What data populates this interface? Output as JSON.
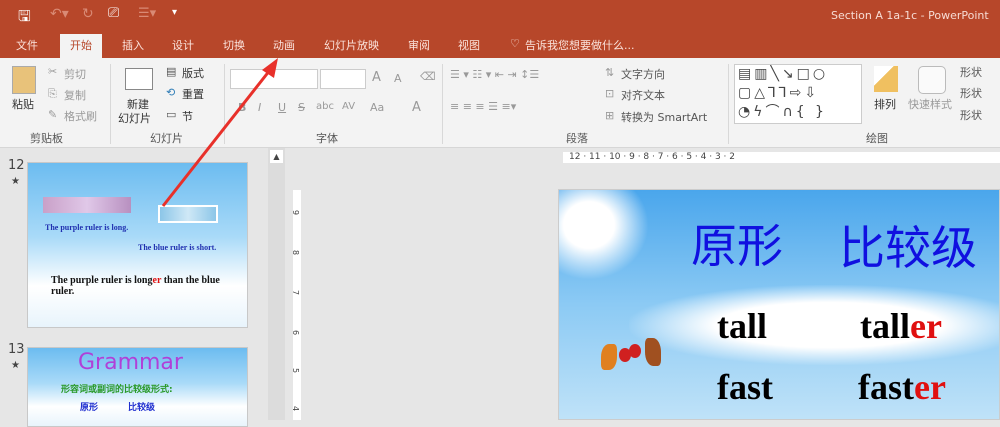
{
  "titlebar": {
    "title": "Section A 1a-1c - PowerPoint"
  },
  "tabs": [
    {
      "label": "文件"
    },
    {
      "label": "开始"
    },
    {
      "label": "插入"
    },
    {
      "label": "设计"
    },
    {
      "label": "切换"
    },
    {
      "label": "动画"
    },
    {
      "label": "幻灯片放映"
    },
    {
      "label": "审阅"
    },
    {
      "label": "视图"
    }
  ],
  "tell_me": "告诉我您想要做什么...",
  "ribbon": {
    "clipboard": {
      "paste": "粘贴",
      "cut": "剪切",
      "copy": "复制",
      "format_painter": "格式刷",
      "label": "剪贴板"
    },
    "slides": {
      "new_slide_1": "新建",
      "new_slide_2": "幻灯片",
      "layout": "版式",
      "reset": "重置",
      "section": "节",
      "label": "幻灯片"
    },
    "font": {
      "label": "字体",
      "grow": "A",
      "shrink": "A",
      "bold": "B",
      "italic": "I",
      "underline": "U",
      "strike": "S",
      "abc": "abc",
      "spacing": "AV",
      "case": "Aa",
      "color": "A"
    },
    "paragraph": {
      "text_direction": "文字方向",
      "align_text": "对齐文本",
      "smartart": "转换为 SmartArt",
      "label": "段落"
    },
    "drawing": {
      "arrange": "排列",
      "quick_styles": "快速样式",
      "shape_fill": "形状",
      "shape_outline": "形状",
      "shape_effects": "形状",
      "label": "绘图"
    }
  },
  "thumbnails": [
    {
      "number": "12",
      "star": "★",
      "text1": "The purple ruler is long.",
      "text2": "The blue ruler is short.",
      "text3a": "The purple ruler is long",
      "text3b": "er",
      "text3c": " than the blue ruler."
    },
    {
      "number": "13",
      "star": "★",
      "title": "Grammar",
      "subtitle": "形容词或副词的比较级形式:",
      "col1": "原形",
      "col2": "比较级"
    }
  ],
  "ruler": {
    "h": "12 · 11 · 10 · 9 · 8 · 7 · 6 · 5 · 4 · 3 · 2",
    "v": [
      "9",
      "8",
      "7",
      "6",
      "5",
      "4"
    ]
  },
  "slide": {
    "heading1": "原形",
    "heading2": "比较级",
    "rows": [
      {
        "base": "tall",
        "comp_stem": "tall",
        "comp_suffix": "er"
      },
      {
        "base": "fast",
        "comp_stem": "fast",
        "comp_suffix": "er"
      }
    ]
  }
}
